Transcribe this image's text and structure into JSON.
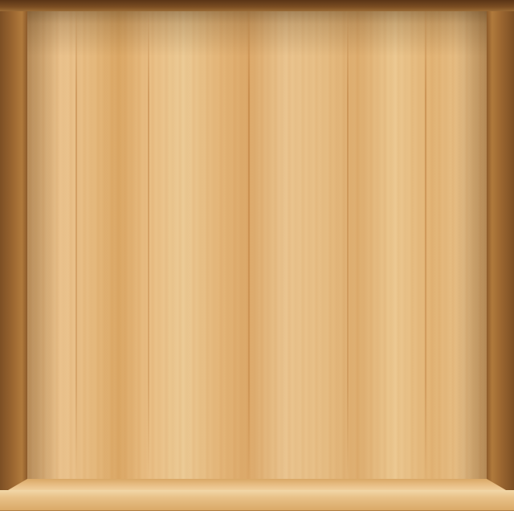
{
  "scene": {
    "colors": {
      "back_wall": "#e6bb80",
      "side_panel": "#9a6530",
      "frame_top": "#5a3516",
      "shelf_front": "#e8c188"
    },
    "shelf_count": 1
  }
}
